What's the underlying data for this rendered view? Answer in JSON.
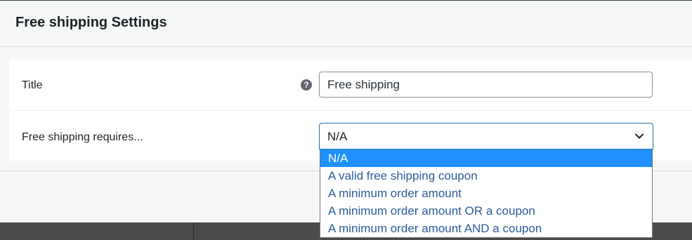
{
  "header": {
    "title": "Free shipping Settings"
  },
  "fields": {
    "title": {
      "label": "Title",
      "value": "Free shipping",
      "help_icon": "question-circle-icon"
    },
    "requires": {
      "label": "Free shipping requires...",
      "selected": "N/A",
      "chevron_icon": "chevron-down-icon",
      "options": [
        "N/A",
        "A valid free shipping coupon",
        "A minimum order amount",
        "A minimum order amount OR a coupon",
        "A minimum order amount AND a coupon"
      ],
      "highlighted_option": "N/A"
    }
  },
  "colors": {
    "accent": "#2271b1",
    "highlight": "#1e90ff",
    "option_text": "#2c5a9c"
  }
}
